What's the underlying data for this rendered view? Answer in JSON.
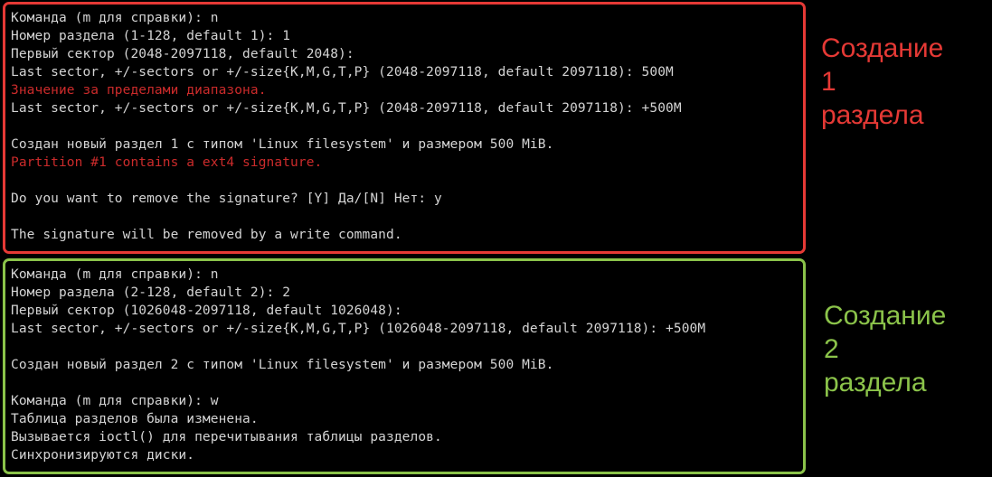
{
  "colors": {
    "background": "#000000",
    "text": "#d4d4d4",
    "error_text": "#cc2b2b",
    "box1_border": "#e53935",
    "box2_border": "#8bc34a"
  },
  "block1": {
    "lines": [
      {
        "text": "Команда (m для справки): n",
        "type": "normal"
      },
      {
        "text": "Номер раздела (1-128, default 1): 1",
        "type": "normal"
      },
      {
        "text": "Первый сектор (2048-2097118, default 2048):",
        "type": "normal"
      },
      {
        "text": "Last sector, +/-sectors or +/-size{K,M,G,T,P} (2048-2097118, default 2097118): 500M",
        "type": "normal"
      },
      {
        "text": "Значение за пределами диапазона.",
        "type": "error"
      },
      {
        "text": "Last sector, +/-sectors or +/-size{K,M,G,T,P} (2048-2097118, default 2097118): +500M",
        "type": "normal"
      },
      {
        "text": "",
        "type": "normal"
      },
      {
        "text": "Создан новый раздел 1 с типом 'Linux filesystem' и размером 500 MiB.",
        "type": "normal"
      },
      {
        "text": "Partition #1 contains a ext4 signature.",
        "type": "error"
      },
      {
        "text": "",
        "type": "normal"
      },
      {
        "text": "Do you want to remove the signature? [Y] Да/[N] Нет: y",
        "type": "normal"
      },
      {
        "text": "",
        "type": "normal"
      },
      {
        "text": "The signature will be removed by a write command.",
        "type": "normal"
      }
    ],
    "annotation": [
      "Создание",
      "1",
      "раздела"
    ]
  },
  "block2": {
    "lines": [
      {
        "text": "Команда (m для справки): n",
        "type": "normal"
      },
      {
        "text": "Номер раздела (2-128, default 2): 2",
        "type": "normal"
      },
      {
        "text": "Первый сектор (1026048-2097118, default 1026048):",
        "type": "normal"
      },
      {
        "text": "Last sector, +/-sectors or +/-size{K,M,G,T,P} (1026048-2097118, default 2097118): +500M",
        "type": "normal"
      },
      {
        "text": "",
        "type": "normal"
      },
      {
        "text": "Создан новый раздел 2 с типом 'Linux filesystem' и размером 500 MiB.",
        "type": "normal"
      },
      {
        "text": "",
        "type": "normal"
      },
      {
        "text": "Команда (m для справки): w",
        "type": "normal"
      },
      {
        "text": "Таблица разделов была изменена.",
        "type": "normal"
      },
      {
        "text": "Вызывается ioctl() для перечитывания таблицы разделов.",
        "type": "normal"
      },
      {
        "text": "Синхронизируются диски.",
        "type": "normal"
      }
    ],
    "annotation": [
      "Создание",
      "2",
      "раздела"
    ]
  }
}
